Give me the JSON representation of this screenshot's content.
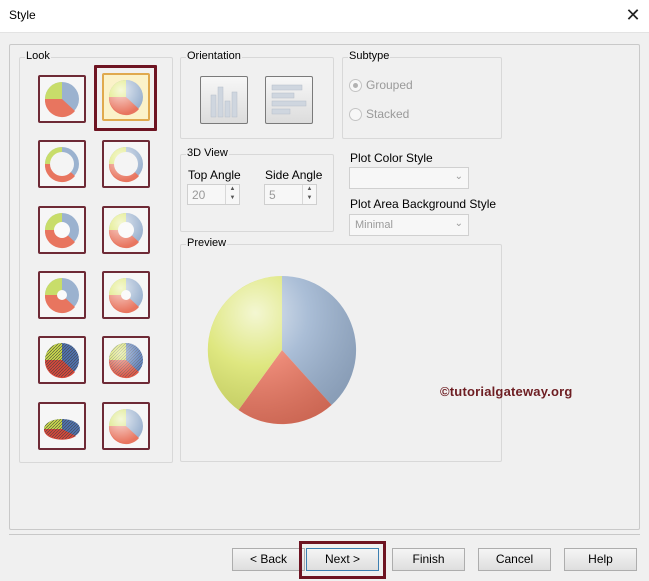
{
  "window": {
    "title": "Style",
    "close_glyph": "✕"
  },
  "look": {
    "label": "Look",
    "styles": [
      "flat-pie",
      "3d-pie-selected",
      "thin-ring",
      "ring-lit",
      "donut",
      "donut-lit",
      "small-hole-donut",
      "small-hole-donut-lit",
      "textured-pie",
      "textured-pie-lit",
      "tilted-textured-pie",
      "lit-pie"
    ],
    "selected_index": 1
  },
  "orientation": {
    "label": "Orientation",
    "options": [
      "vertical-bars",
      "horizontal-bars"
    ]
  },
  "subtype": {
    "label": "Subtype",
    "options": [
      "Grouped",
      "Stacked"
    ],
    "selected": "Grouped"
  },
  "view3d": {
    "label": "3D View",
    "top_angle_label": "Top Angle",
    "top_angle_value": "20",
    "side_angle_label": "Side Angle",
    "side_angle_value": "5"
  },
  "plot_color_style": {
    "label": "Plot Color Style",
    "value": ""
  },
  "plot_area_bg_style": {
    "label": "Plot Area Background Style",
    "value": "Minimal"
  },
  "preview": {
    "label": "Preview",
    "watermark": "©tutorialgateway.org"
  },
  "colors": {
    "yellow_green": "#d9e36a",
    "steel_blue": "#9bb2cf",
    "salmon": "#e8755f",
    "highlight": "#6e1422"
  },
  "buttons": {
    "back": "< Back",
    "next": "Next >",
    "finish": "Finish",
    "cancel": "Cancel",
    "help": "Help"
  }
}
